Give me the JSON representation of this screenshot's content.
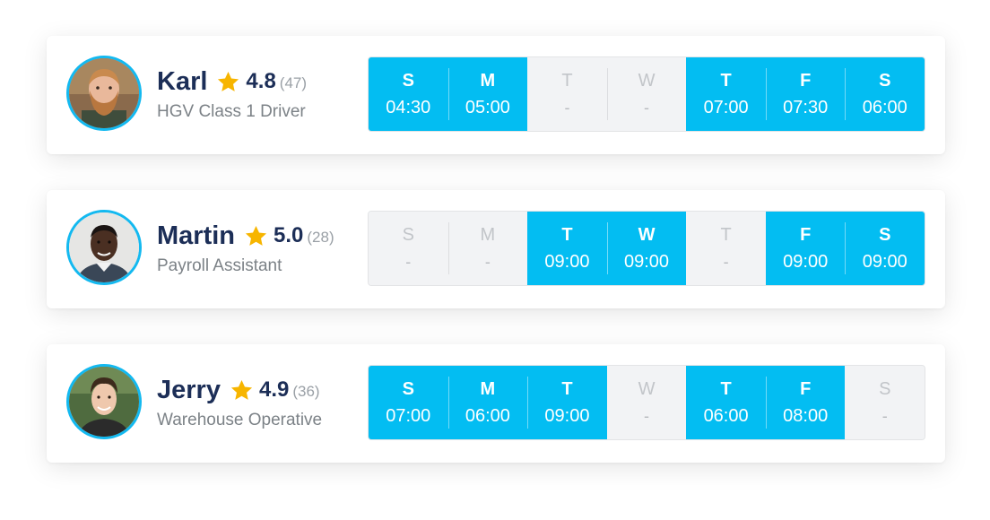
{
  "colors": {
    "accent": "#03bdf2",
    "avatar_ring": "#13b9f0",
    "name": "#1c2e57",
    "star": "#f7b500",
    "off_day_bg": "#f2f3f5",
    "subtext": "#7c8287"
  },
  "workers": [
    {
      "name": "Karl",
      "rating": "4.8",
      "review_count": "(47)",
      "role": "HGV Class 1 Driver",
      "avatar_icon": "avatar-karl",
      "schedule": [
        {
          "letter": "S",
          "time": "04:30",
          "active": true
        },
        {
          "letter": "M",
          "time": "05:00",
          "active": true
        },
        {
          "letter": "T",
          "time": "-",
          "active": false
        },
        {
          "letter": "W",
          "time": "-",
          "active": false
        },
        {
          "letter": "T",
          "time": "07:00",
          "active": true
        },
        {
          "letter": "F",
          "time": "07:30",
          "active": true
        },
        {
          "letter": "S",
          "time": "06:00",
          "active": true
        }
      ]
    },
    {
      "name": "Martin",
      "rating": "5.0",
      "review_count": "(28)",
      "role": "Payroll Assistant",
      "avatar_icon": "avatar-martin",
      "schedule": [
        {
          "letter": "S",
          "time": "-",
          "active": false
        },
        {
          "letter": "M",
          "time": "-",
          "active": false
        },
        {
          "letter": "T",
          "time": "09:00",
          "active": true
        },
        {
          "letter": "W",
          "time": "09:00",
          "active": true
        },
        {
          "letter": "T",
          "time": "-",
          "active": false
        },
        {
          "letter": "F",
          "time": "09:00",
          "active": true
        },
        {
          "letter": "S",
          "time": "09:00",
          "active": true
        }
      ]
    },
    {
      "name": "Jerry",
      "rating": "4.9",
      "review_count": "(36)",
      "role": "Warehouse Operative",
      "avatar_icon": "avatar-jerry",
      "schedule": [
        {
          "letter": "S",
          "time": "07:00",
          "active": true
        },
        {
          "letter": "M",
          "time": "06:00",
          "active": true
        },
        {
          "letter": "T",
          "time": "09:00",
          "active": true
        },
        {
          "letter": "W",
          "time": "-",
          "active": false
        },
        {
          "letter": "T",
          "time": "06:00",
          "active": true
        },
        {
          "letter": "F",
          "time": "08:00",
          "active": true
        },
        {
          "letter": "S",
          "time": "-",
          "active": false
        }
      ]
    }
  ]
}
